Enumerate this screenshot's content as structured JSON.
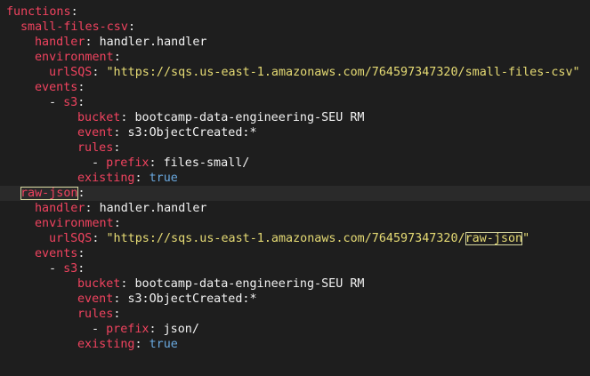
{
  "editor": {
    "lines": [
      {
        "indent": 0,
        "key": "functions",
        "sep": ":",
        "value": "",
        "value_type": "none"
      },
      {
        "indent": 1,
        "key": "small-files-csv",
        "sep": ":",
        "value": "",
        "value_type": "none"
      },
      {
        "indent": 2,
        "key": "handler",
        "sep": ": ",
        "value": "handler.handler",
        "value_type": "plain"
      },
      {
        "indent": 2,
        "key": "environment",
        "sep": ":",
        "value": "",
        "value_type": "none"
      },
      {
        "indent": 3,
        "key": "urlSQS",
        "sep": ": ",
        "value": "\"https://sqs.us-east-1.amazonaws.com/764597347320/small-files-csv\"",
        "value_type": "string"
      },
      {
        "indent": 2,
        "key": "events",
        "sep": ":",
        "value": "",
        "value_type": "none"
      },
      {
        "indent": 3,
        "dash": "- ",
        "key": "s3",
        "sep": ":",
        "value": "",
        "value_type": "none"
      },
      {
        "indent": 5,
        "key": "bucket",
        "sep": ": ",
        "value": "bootcamp-data-engineering-SEU RM",
        "value_type": "plain"
      },
      {
        "indent": 5,
        "key": "event",
        "sep": ": ",
        "value": "s3:ObjectCreated:*",
        "value_type": "plain"
      },
      {
        "indent": 5,
        "key": "rules",
        "sep": ":",
        "value": "",
        "value_type": "none"
      },
      {
        "indent": 6,
        "dash": "- ",
        "key": "prefix",
        "sep": ": ",
        "value": "files-small/",
        "value_type": "plain"
      },
      {
        "indent": 5,
        "key": "existing",
        "sep": ": ",
        "value": "true",
        "value_type": "bool"
      },
      {
        "indent": 1,
        "key": "raw-json",
        "sep": ":",
        "value": "",
        "value_type": "none",
        "current": true,
        "key_highlight": true
      },
      {
        "indent": 2,
        "key": "handler",
        "sep": ": ",
        "value": "handler.handler",
        "value_type": "plain"
      },
      {
        "indent": 2,
        "key": "environment",
        "sep": ":",
        "value": "",
        "value_type": "none"
      },
      {
        "indent": 3,
        "key": "urlSQS",
        "sep": ": ",
        "value_pre": "\"https://sqs.us-east-1.amazonaws.com/764597347320/",
        "value_hl": "raw-json",
        "value_post": "\"",
        "value_type": "string_hl"
      },
      {
        "indent": 2,
        "key": "events",
        "sep": ":",
        "value": "",
        "value_type": "none"
      },
      {
        "indent": 3,
        "dash": "- ",
        "key": "s3",
        "sep": ":",
        "value": "",
        "value_type": "none"
      },
      {
        "indent": 5,
        "key": "bucket",
        "sep": ": ",
        "value": "bootcamp-data-engineering-SEU RM",
        "value_type": "plain"
      },
      {
        "indent": 5,
        "key": "event",
        "sep": ": ",
        "value": "s3:ObjectCreated:*",
        "value_type": "plain"
      },
      {
        "indent": 5,
        "key": "rules",
        "sep": ":",
        "value": "",
        "value_type": "none"
      },
      {
        "indent": 6,
        "dash": "- ",
        "key": "prefix",
        "sep": ": ",
        "value": "json/",
        "value_type": "plain"
      },
      {
        "indent": 5,
        "key": "existing",
        "sep": ": ",
        "value": "true",
        "value_type": "bool"
      }
    ]
  },
  "colors": {
    "background": "#1e1e1e",
    "key": "#f0435f",
    "string": "#e6db74",
    "bool": "#6aa9e0",
    "plain": "#f2f2f2"
  }
}
